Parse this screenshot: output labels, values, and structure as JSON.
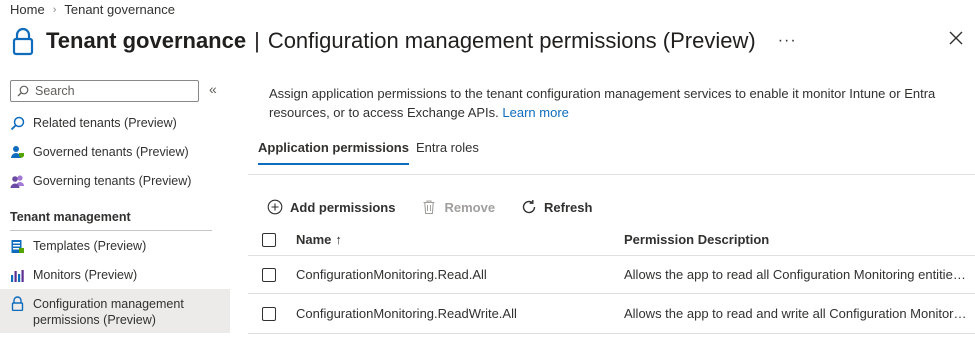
{
  "breadcrumb": {
    "home": "Home",
    "separator": "›",
    "current": "Tenant governance"
  },
  "header": {
    "title": "Tenant governance",
    "separator": "|",
    "subtitle": "Configuration management permissions (Preview)",
    "more": "···",
    "icon": "lock-icon"
  },
  "sidebar": {
    "search_placeholder": "Search",
    "collapse": "«",
    "items": [
      {
        "label": "Related tenants (Preview)",
        "icon": "search-icon"
      },
      {
        "label": "Governed tenants (Preview)",
        "icon": "user-shield-icon"
      },
      {
        "label": "Governing tenants (Preview)",
        "icon": "users-icon"
      }
    ],
    "section": "Tenant management",
    "section_items": [
      {
        "label": "Templates (Preview)",
        "icon": "template-icon"
      },
      {
        "label": "Monitors (Preview)",
        "icon": "chart-icon"
      },
      {
        "label_line1": "Configuration management",
        "label_line2": "permissions (Preview)",
        "icon": "lock-icon",
        "active": true
      }
    ]
  },
  "main": {
    "description": "Assign application permissions to the tenant configuration management services to enable it monitor Intune or Entra resources, or to access Exchange APIs.",
    "learn_more": "Learn more",
    "tabs": [
      {
        "label": "Application permissions",
        "active": true
      },
      {
        "label": "Entra roles",
        "active": false
      }
    ],
    "toolbar": {
      "add": "Add permissions",
      "remove": "Remove",
      "refresh": "Refresh"
    },
    "table": {
      "col_name": "Name",
      "sort_indicator": "↑",
      "col_desc": "Permission Description",
      "rows": [
        {
          "name": "ConfigurationMonitoring.Read.All",
          "desc": "Allows the app to read all Configuration Monitoring entities and settings"
        },
        {
          "name": "ConfigurationMonitoring.ReadWrite.All",
          "desc": "Allows the app to read and write all Configuration Monitoring entities and settings"
        }
      ]
    }
  },
  "colors": {
    "accent": "#0f6cbd",
    "text": "#323130",
    "active_bg": "#edebe9",
    "divider": "#e1dfdd"
  }
}
